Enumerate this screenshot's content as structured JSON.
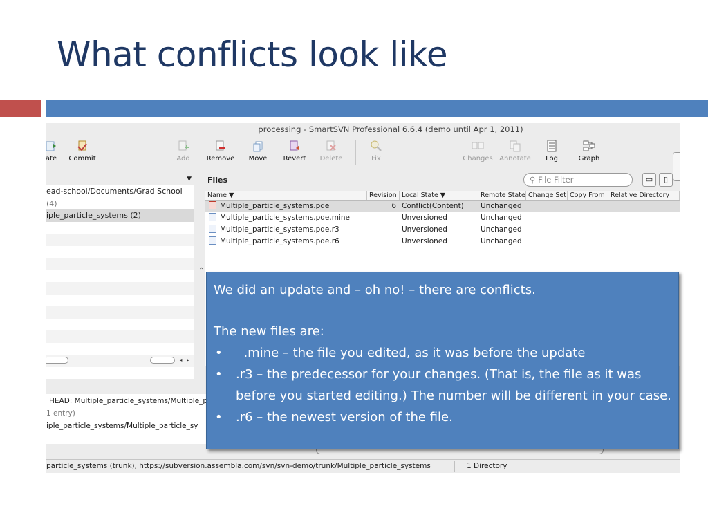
{
  "slide": {
    "title": "What conflicts look like"
  },
  "window": {
    "title": "processing - SmartSVN Professional 6.6.4 (demo until Apr 1, 2011)"
  },
  "toolbar": {
    "buttons": [
      {
        "label": "ate",
        "enabled": true
      },
      {
        "label": "Commit",
        "enabled": true
      },
      {
        "label": "Add",
        "enabled": false
      },
      {
        "label": "Remove",
        "enabled": true
      },
      {
        "label": "Move",
        "enabled": true
      },
      {
        "label": "Revert",
        "enabled": true
      },
      {
        "label": "Delete",
        "enabled": false
      },
      {
        "label": "Fix",
        "enabled": false
      },
      {
        "label": "Changes",
        "enabled": false
      },
      {
        "label": "Annotate",
        "enabled": false
      },
      {
        "label": "Log",
        "enabled": true
      },
      {
        "label": "Graph",
        "enabled": true
      }
    ]
  },
  "tree": {
    "path": "ead-school/Documents/Grad School",
    "count": "(4)",
    "selected": "iple_particle_systems (2)"
  },
  "files": {
    "label": "Files",
    "filter_placeholder": "File Filter",
    "columns": [
      "Name ▼",
      "Revision",
      "Local State ▼",
      "Remote State",
      "Change Set",
      "Copy From",
      "Relative Directory"
    ],
    "rows": [
      {
        "name": "Multiple_particle_systems.pde",
        "revision": "6",
        "local_state": "Conflict(Content)",
        "remote_state": "Unchanged",
        "conflict": true
      },
      {
        "name": "Multiple_particle_systems.pde.mine",
        "revision": "",
        "local_state": "Unversioned",
        "remote_state": "Unchanged",
        "conflict": false
      },
      {
        "name": "Multiple_particle_systems.pde.r3",
        "revision": "",
        "local_state": "Unversioned",
        "remote_state": "Unchanged",
        "conflict": false
      },
      {
        "name": "Multiple_particle_systems.pde.r6",
        "revision": "",
        "local_state": "Unversioned",
        "remote_state": "Unchanged",
        "conflict": false
      }
    ]
  },
  "log_pane": {
    "head": "HEAD: Multiple_particle_systems/Multiple_p",
    "entries": "1 entry)",
    "path": "iple_particle_systems/Multiple_particle_sy"
  },
  "status_bar": {
    "path": "particle_systems (trunk), https://subversion.assembla.com/svn/svn-demo/trunk/Multiple_particle_systems",
    "directory": "1 Directory"
  },
  "callout": {
    "line1": "We did an update and – oh no! – there are conflicts.",
    "line2": "The new files are:",
    "bullet_char": "•",
    "bullets": [
      "  .mine – the file you edited, as it was before the update",
      ".r3 – the predecessor for your changes. (That is, the file as it was before you started editing.) The number will be different in your case.",
      ".r6 – the newest version of the file."
    ]
  }
}
